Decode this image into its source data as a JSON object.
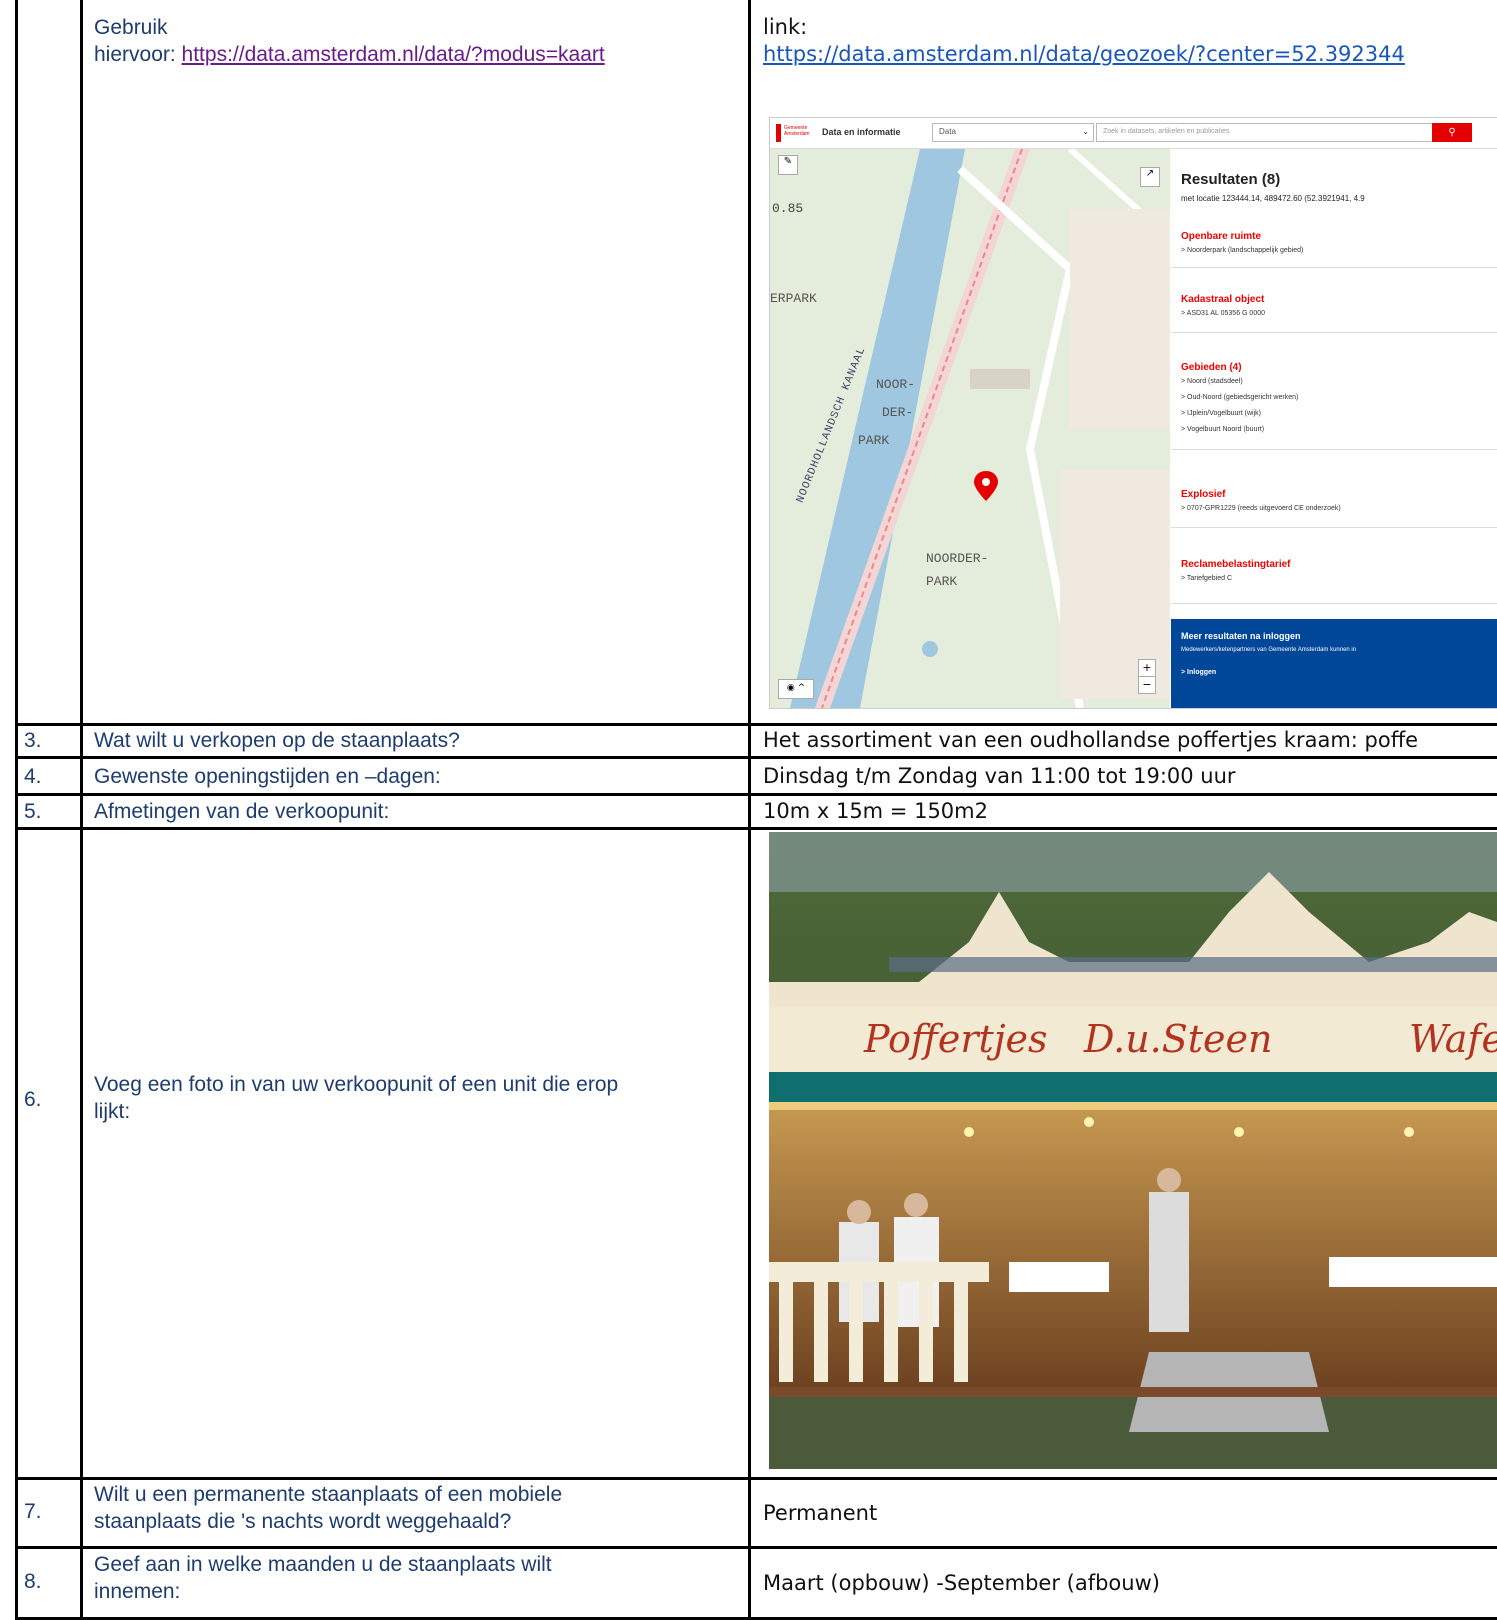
{
  "row_top": {
    "left_line1": "Gebruik",
    "left_line2_prefix": "hiervoor: ",
    "left_link": "https://data.amsterdam.nl/data/?modus=kaart",
    "right_line1": "link:",
    "right_link": "https://data.amsterdam.nl/data/geozoek/?center=52.392344"
  },
  "map_screenshot": {
    "brand": "Gemeente Amsterdam",
    "app_title": "Data en informatie",
    "select_value": "Data",
    "search_placeholder": "Zoek in datasets, artikelen en publicaties",
    "scale_text": "0.85",
    "labels": [
      "ERPARK",
      "NOOR-",
      "DER-",
      "PARK",
      "NOORDER-",
      "PARK",
      "NOORDHOLLANDSCH KANAAL"
    ],
    "results_title": "Resultaten (8)",
    "results_sub": "met locatie 123444.14, 489472.60 (52.3921941, 4.9",
    "sections": [
      {
        "title": "Openbare ruimte",
        "items": [
          "> Noorderpark (landschappelijk gebied)"
        ]
      },
      {
        "title": "Kadastraal object",
        "items": [
          "> ASD31 AL 05356 G 0000"
        ]
      },
      {
        "title": "Gebieden (4)",
        "items": [
          "> Noord (stadsdeel)",
          "> Oud-Noord (gebiedsgericht werken)",
          "> IJplein/Vogelbuurt (wijk)",
          "> Vogelbuurt Noord (buurt)"
        ]
      },
      {
        "title": "Explosief",
        "items": [
          "> 0707-GPR1229 (reeds uitgevoerd CE onderzoek)"
        ]
      },
      {
        "title": "Reclamebelastingtarief",
        "items": [
          "> Tariefgebied C"
        ]
      }
    ],
    "banner_title": "Meer resultaten na inloggen",
    "banner_text": "Medewerkers/ketenpartners van Gemeente Amsterdam kunnen in",
    "banner_link": "> Inloggen",
    "accent": "#e50000",
    "banner_color": "#004699"
  },
  "rows": [
    {
      "num": "3.",
      "question": "Wat wilt u verkopen op de staanplaats?",
      "answer": "Het assortiment van een oudhollandse poffertjes kraam: poffe"
    },
    {
      "num": "4.",
      "question": "Gewenste openingstijden en –dagen:",
      "answer": "Dinsdag t/m Zondag van 11:00 tot 19:00 uur"
    },
    {
      "num": "5.",
      "question": "Afmetingen van de verkoopunit:",
      "answer": "10m x 15m = 150m2"
    },
    {
      "num": "6.",
      "question_line1": "Voeg een foto in van uw verkoopunit of een unit die erop",
      "question_line2": "lijkt:"
    },
    {
      "num": "7.",
      "question_line1": "Wilt u een permanente staanplaats of een mobiele",
      "question_line2": "staanplaats die 's nachts wordt weggehaald?",
      "answer": "Permanent"
    },
    {
      "num": "8.",
      "question_line1": "Geef aan in welke maanden u de staanplaats wilt",
      "question_line2": "innemen:",
      "answer": "Maart (opbouw) -September (afbouw)"
    }
  ],
  "photo": {
    "sign_left": "Poffertjes",
    "sign_mid": "D.u.Steen",
    "sign_right": "Wafe"
  }
}
